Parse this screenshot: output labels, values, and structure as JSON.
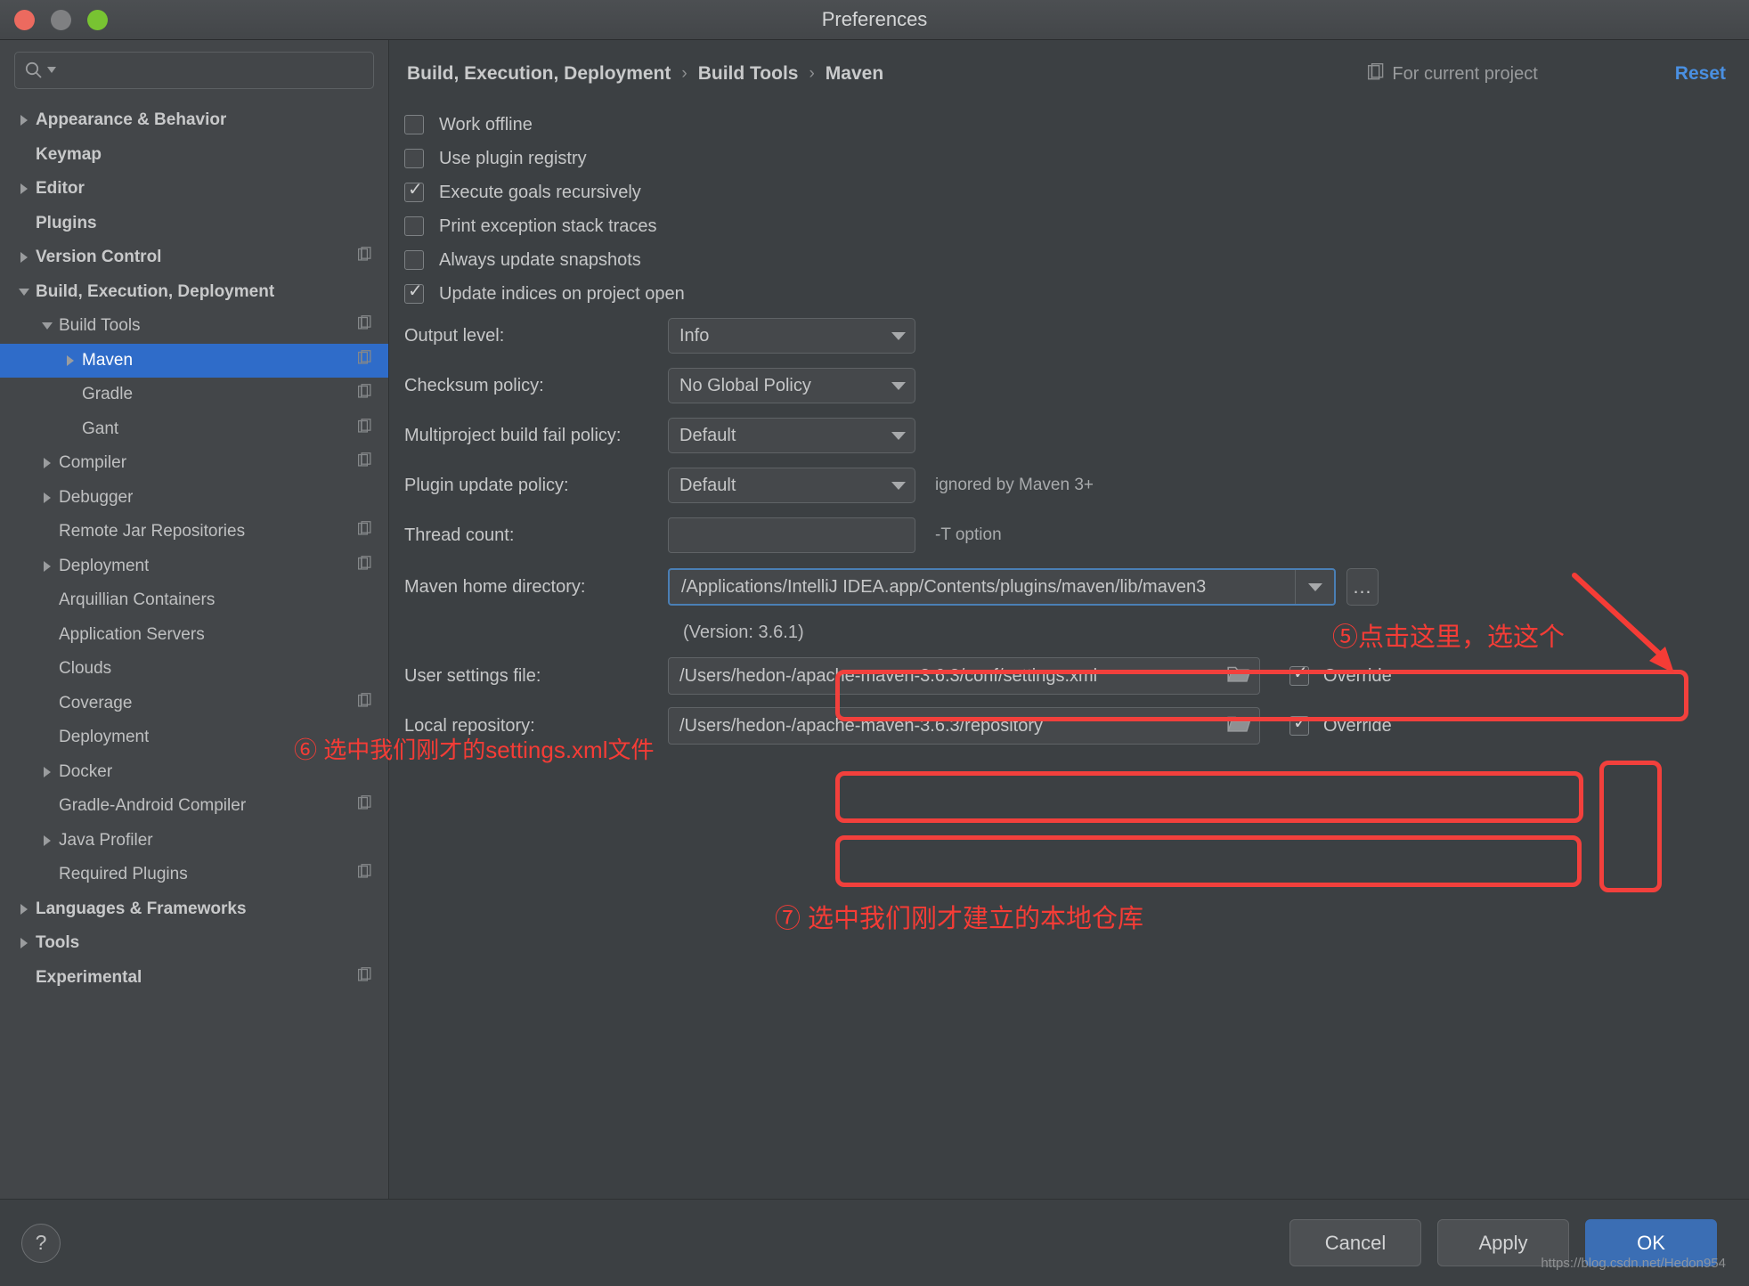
{
  "window": {
    "title": "Preferences"
  },
  "sidebar": {
    "search": {
      "placeholder": "",
      "value": "",
      "icon": "search-icon"
    },
    "items": [
      {
        "label": "Appearance & Behavior",
        "indent": 0,
        "arrow": "right",
        "bold": true,
        "project_icon": false,
        "selected": false
      },
      {
        "label": "Keymap",
        "indent": 0,
        "arrow": "none",
        "bold": true,
        "project_icon": false,
        "selected": false
      },
      {
        "label": "Editor",
        "indent": 0,
        "arrow": "right",
        "bold": true,
        "project_icon": false,
        "selected": false
      },
      {
        "label": "Plugins",
        "indent": 0,
        "arrow": "none",
        "bold": true,
        "project_icon": false,
        "selected": false
      },
      {
        "label": "Version Control",
        "indent": 0,
        "arrow": "right",
        "bold": true,
        "project_icon": true,
        "selected": false
      },
      {
        "label": "Build, Execution, Deployment",
        "indent": 0,
        "arrow": "down",
        "bold": true,
        "project_icon": false,
        "selected": false
      },
      {
        "label": "Build Tools",
        "indent": 1,
        "arrow": "down",
        "bold": false,
        "project_icon": true,
        "selected": false
      },
      {
        "label": "Maven",
        "indent": 2,
        "arrow": "right",
        "bold": false,
        "project_icon": true,
        "selected": true
      },
      {
        "label": "Gradle",
        "indent": 2,
        "arrow": "none",
        "bold": false,
        "project_icon": true,
        "selected": false
      },
      {
        "label": "Gant",
        "indent": 2,
        "arrow": "none",
        "bold": false,
        "project_icon": true,
        "selected": false
      },
      {
        "label": "Compiler",
        "indent": 1,
        "arrow": "right",
        "bold": false,
        "project_icon": true,
        "selected": false
      },
      {
        "label": "Debugger",
        "indent": 1,
        "arrow": "right",
        "bold": false,
        "project_icon": false,
        "selected": false
      },
      {
        "label": "Remote Jar Repositories",
        "indent": 1,
        "arrow": "none",
        "bold": false,
        "project_icon": true,
        "selected": false
      },
      {
        "label": "Deployment",
        "indent": 1,
        "arrow": "right",
        "bold": false,
        "project_icon": true,
        "selected": false
      },
      {
        "label": "Arquillian Containers",
        "indent": 1,
        "arrow": "none",
        "bold": false,
        "project_icon": false,
        "selected": false
      },
      {
        "label": "Application Servers",
        "indent": 1,
        "arrow": "none",
        "bold": false,
        "project_icon": false,
        "selected": false
      },
      {
        "label": "Clouds",
        "indent": 1,
        "arrow": "none",
        "bold": false,
        "project_icon": false,
        "selected": false
      },
      {
        "label": "Coverage",
        "indent": 1,
        "arrow": "none",
        "bold": false,
        "project_icon": true,
        "selected": false
      },
      {
        "label": "Deployment",
        "indent": 1,
        "arrow": "none",
        "bold": false,
        "project_icon": false,
        "selected": false
      },
      {
        "label": "Docker",
        "indent": 1,
        "arrow": "right",
        "bold": false,
        "project_icon": false,
        "selected": false
      },
      {
        "label": "Gradle-Android Compiler",
        "indent": 1,
        "arrow": "none",
        "bold": false,
        "project_icon": true,
        "selected": false
      },
      {
        "label": "Java Profiler",
        "indent": 1,
        "arrow": "right",
        "bold": false,
        "project_icon": false,
        "selected": false
      },
      {
        "label": "Required Plugins",
        "indent": 1,
        "arrow": "none",
        "bold": false,
        "project_icon": true,
        "selected": false
      },
      {
        "label": "Languages & Frameworks",
        "indent": 0,
        "arrow": "right",
        "bold": true,
        "project_icon": false,
        "selected": false
      },
      {
        "label": "Tools",
        "indent": 0,
        "arrow": "right",
        "bold": true,
        "project_icon": false,
        "selected": false
      },
      {
        "label": "Experimental",
        "indent": 0,
        "arrow": "none",
        "bold": true,
        "project_icon": true,
        "selected": false
      }
    ]
  },
  "header": {
    "breadcrumb": [
      "Build, Execution, Deployment",
      "Build Tools",
      "Maven"
    ],
    "separator": "›",
    "for_current_project": "For current project",
    "for_current_project_icon": "project-scope-icon",
    "reset_label": "Reset"
  },
  "main": {
    "checkboxes": [
      {
        "label": "Work offline",
        "checked": false
      },
      {
        "label": "Use plugin registry",
        "checked": false
      },
      {
        "label": "Execute goals recursively",
        "checked": true
      },
      {
        "label": "Print exception stack traces",
        "checked": false
      },
      {
        "label": "Always update snapshots",
        "checked": false
      },
      {
        "label": "Update indices on project open",
        "checked": true
      }
    ],
    "combos": [
      {
        "label": "Output level:",
        "value": "Info",
        "hint": ""
      },
      {
        "label": "Checksum policy:",
        "value": "No Global Policy",
        "hint": ""
      },
      {
        "label": "Multiproject build fail policy:",
        "value": "Default",
        "hint": ""
      },
      {
        "label": "Plugin update policy:",
        "value": "Default",
        "hint": "ignored by Maven 3+"
      }
    ],
    "thread_count": {
      "label": "Thread count:",
      "value": "",
      "placeholder": "",
      "hint": "-T option"
    },
    "maven_home": {
      "label": "Maven home directory:",
      "value": "/Applications/IntelliJ IDEA.app/Contents/plugins/maven/lib/maven3",
      "ellipsis_label": "…",
      "version_note": "(Version: 3.6.1)"
    },
    "user_settings": {
      "label": "User settings file:",
      "value": "/Users/hedon-/apache-maven-3.6.3/conf/settings.xml",
      "browse_icon": "folder-icon",
      "override_label": "Override",
      "override_checked": true
    },
    "local_repository": {
      "label": "Local repository:",
      "value": "/Users/hedon-/apache-maven-3.6.3/repository",
      "browse_icon": "folder-icon",
      "override_label": "Override",
      "override_checked": true
    }
  },
  "annotations": {
    "color": "#f53c36",
    "step5": "⑤点击这里，选这个",
    "step6": "⑥ 选中我们刚才的settings.xml文件",
    "step7": "⑦ 选中我们刚才建立的本地仓库"
  },
  "footer": {
    "help_label": "?",
    "cancel_label": "Cancel",
    "apply_label": "Apply",
    "ok_label": "OK",
    "watermark": "https://blog.csdn.net/Hedon954"
  }
}
